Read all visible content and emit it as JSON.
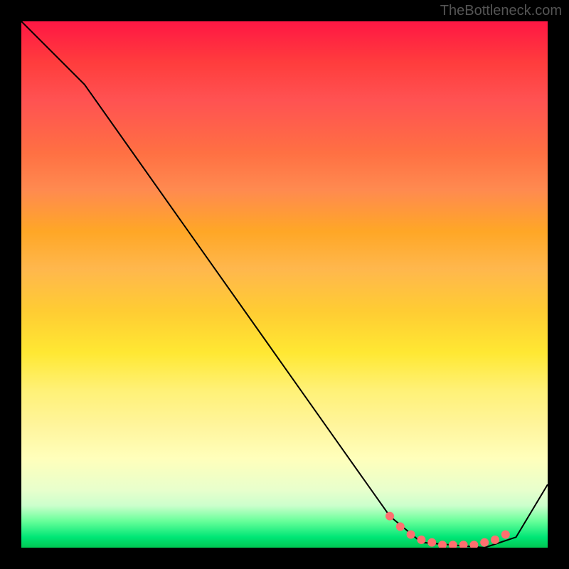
{
  "attribution": "TheBottleneck.com",
  "chart_data": {
    "type": "line",
    "title": "",
    "xlabel": "",
    "ylabel": "",
    "xlim": [
      0,
      100
    ],
    "ylim": [
      0,
      100
    ],
    "series": [
      {
        "name": "bottleneck-curve",
        "x": [
          0,
          12,
          70,
          76,
          88,
          94,
          100
        ],
        "y": [
          100,
          88,
          6,
          1,
          0,
          2,
          12
        ]
      }
    ],
    "markers": {
      "name": "highlight-points",
      "color": "#ff6f6f",
      "x": [
        70,
        72,
        74,
        76,
        78,
        80,
        82,
        84,
        86,
        88,
        90,
        92
      ],
      "y": [
        6,
        4,
        2.5,
        1.5,
        1,
        0.5,
        0.5,
        0.5,
        0.5,
        1,
        1.5,
        2.5
      ]
    },
    "background_gradient": {
      "top": "#ff1744",
      "middle": "#ffee33",
      "bottom": "#00c853"
    }
  }
}
